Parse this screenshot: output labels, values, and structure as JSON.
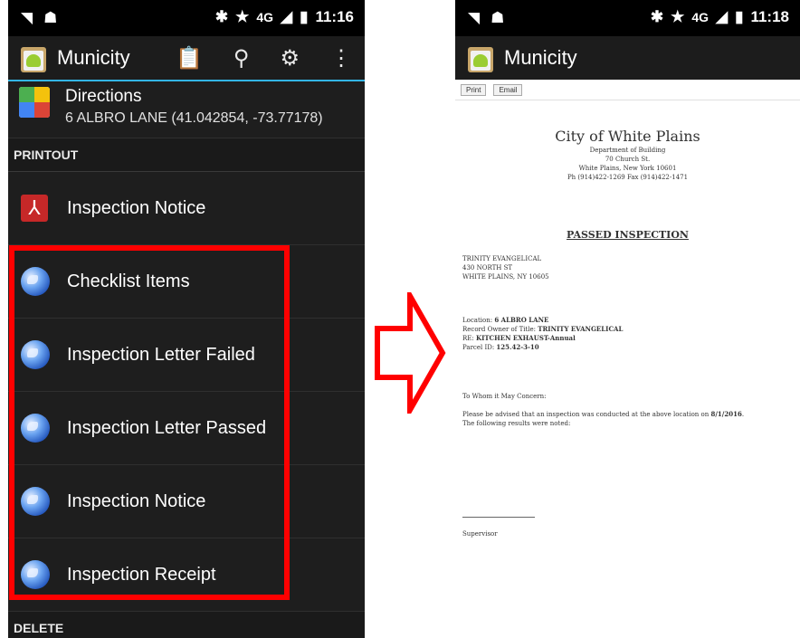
{
  "left_phone": {
    "status": {
      "time": "11:16",
      "network": "4G"
    },
    "app_title": "Municity",
    "actions": [
      "clipboard-icon",
      "search-icon",
      "gear-icon",
      "overflow-menu-icon"
    ],
    "directions": {
      "title": "Directions",
      "subtitle": "6 ALBRO LANE  (41.042854, -73.77178)"
    },
    "printout_header": "PRINTOUT",
    "pdf_item": "Inspection Notice",
    "items": [
      "Checklist Items",
      "Inspection Letter Failed",
      "Inspection Letter Passed",
      "Inspection Notice",
      "Inspection Receipt"
    ],
    "delete_header": "DELETE"
  },
  "right_phone": {
    "status": {
      "time": "11:18",
      "network": "4G"
    },
    "app_title": "Municity",
    "buttons": {
      "print": "Print",
      "email": "Email"
    },
    "doc": {
      "city": "City of White Plains",
      "dept": "Department of Building",
      "street": "70 Church St.",
      "citystate": "White Plains, New York 10601",
      "phone": "Ph (914)422-1269 Fax (914)422-1471",
      "heading": "PASSED INSPECTION",
      "owner_line1": "TRINITY EVANGELICAL",
      "owner_line2": "430 NORTH ST",
      "owner_line3": "WHITE PLAINS, NY 10605",
      "location_label": "Location:",
      "location_value": "6 ALBRO LANE",
      "record_label": "Record Owner of Title:",
      "record_value": "TRINITY EVANGELICAL",
      "re_label": "RE:",
      "re_value": "KITCHEN EXHAUST-Annual",
      "parcel_label": "Parcel ID:",
      "parcel_value": "125.42-3-10",
      "greeting": "To Whom it May Concern:",
      "body_text": "Please be advised that an inspection was conducted at the above location on",
      "body_date": "8/1/2016",
      "body_text2": "The following results were noted:",
      "signature": "Supervisor"
    }
  },
  "colors": {
    "highlight": "#ff0000",
    "accent": "#33b5e5"
  }
}
